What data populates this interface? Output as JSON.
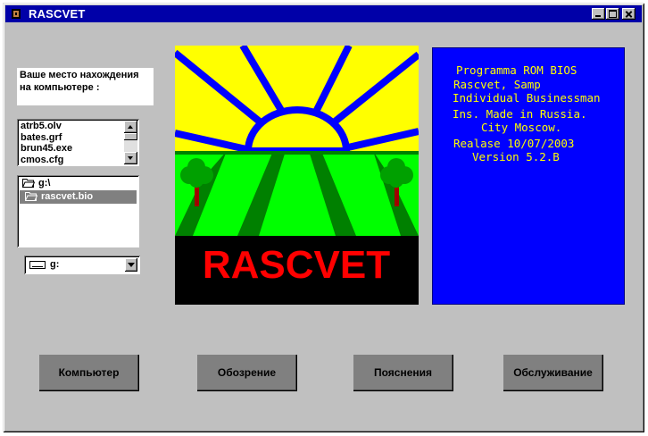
{
  "window": {
    "title": "RASCVET"
  },
  "location": {
    "line1": "Ваше место нахождения",
    "line2": "на компьютере :"
  },
  "file_list": {
    "items": [
      "atrb5.olv",
      "bates.grf",
      "brun45.exe",
      "cmos.cfg"
    ]
  },
  "directory_tree": {
    "items": [
      {
        "label": "g:\\",
        "selected": false
      },
      {
        "label": "rascvet.bio",
        "selected": true
      }
    ]
  },
  "drive_select": {
    "value": "g:"
  },
  "logo": {
    "text": "RASCVET",
    "colors": {
      "sky": "#ffff00",
      "rays": "#0000ff",
      "field": "#00ff00",
      "stripes": "#008000",
      "trees": "#00a000",
      "trunk": "#a00000",
      "band": "#000000",
      "text": "#ff0000"
    }
  },
  "info_panel": {
    "lines": [
      "Programma ROM BIOS",
      "Rascvet, Samp",
      "Individual Businessman",
      "Ins. Made in Russia.",
      "City Moscow.",
      "Realase 10/07/2003",
      "Version 5.2.B"
    ],
    "background": "#0000ff",
    "text_color": "#ffff00"
  },
  "buttons": [
    {
      "label": "Компьютер"
    },
    {
      "label": "Обозрение"
    },
    {
      "label": "Пояснения"
    },
    {
      "label": "Обслуживание"
    }
  ]
}
